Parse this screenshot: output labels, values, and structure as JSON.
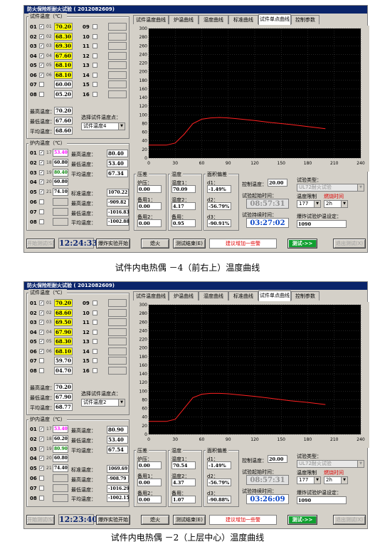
{
  "screens": [
    {
      "title": "防火保险柜耐火试验  ( 2012082609)",
      "sample_group_title": "试件温度（℃）",
      "sample_rows": [
        {
          "num": "01",
          "id": "01",
          "checked": true,
          "value": "70.20",
          "color": "#ffff00"
        },
        {
          "num": "02",
          "id": "02",
          "checked": true,
          "value": "68.30",
          "color": "#ffff00"
        },
        {
          "num": "03",
          "id": "03",
          "checked": true,
          "value": "69.30",
          "color": "#ffff00"
        },
        {
          "num": "04",
          "id": "04",
          "checked": true,
          "value": "67.60",
          "color": "#ffff00"
        },
        {
          "num": "05",
          "id": "05",
          "checked": true,
          "value": "68.10",
          "color": "#ffff00"
        },
        {
          "num": "06",
          "id": "06",
          "checked": true,
          "value": "68.10",
          "color": "#ffff00"
        },
        {
          "num": "07",
          "id": "",
          "checked": false,
          "value": "60.00",
          "color": "#ffffff"
        },
        {
          "num": "08",
          "id": "",
          "checked": false,
          "value": "05.20",
          "color": "#ffffff"
        }
      ],
      "sample_rows_right": [
        "09",
        "10",
        "11",
        "12",
        "13",
        "14",
        "15",
        "16"
      ],
      "max_label": "最高温度：",
      "max_value": "70.20",
      "min_label": "最低温度：",
      "min_value": "67.60",
      "avg_label": "平均温度：",
      "avg_value": "68.60",
      "select_label": "选择试件温度点：",
      "select_value": "试件温度4",
      "furnace_title": "炉内温度（℃）",
      "furnace_rows": [
        {
          "num": "01",
          "id": "17",
          "checked": true,
          "value": "53.40",
          "color": "#ff00ff"
        },
        {
          "num": "02",
          "id": "18",
          "checked": true,
          "value": "60.80",
          "color": "#000000"
        },
        {
          "num": "03",
          "id": "19",
          "checked": true,
          "value": "80.40",
          "color": "#008000"
        },
        {
          "num": "04",
          "id": "20",
          "checked": true,
          "value": "60.80",
          "color": "#000000"
        },
        {
          "num": "05",
          "id": "21",
          "checked": true,
          "value": "74.10",
          "color": "#000000"
        },
        {
          "num": "06",
          "id": "",
          "checked": false,
          "value": "",
          "color": "#000000"
        },
        {
          "num": "07",
          "id": "",
          "checked": false,
          "value": "",
          "color": "#000000"
        },
        {
          "num": "08",
          "id": "",
          "checked": false,
          "value": "",
          "color": "#000000"
        }
      ],
      "furnace_stats": [
        {
          "label": "最高温度：",
          "value": "80.40"
        },
        {
          "label": "最低温度：",
          "value": "53.40"
        },
        {
          "label": "平均温度：",
          "value": "67.34"
        }
      ],
      "std_stats": [
        {
          "label": "标准温度：",
          "value": "1070.22"
        },
        {
          "label": "最高温度：",
          "value": "-909.82"
        },
        {
          "label": "最低温度：",
          "value": "-1016.83"
        },
        {
          "label": "平均温度：",
          "value": "-1002.88"
        }
      ],
      "tabs": [
        "试件温度曲线",
        "炉温曲线",
        "湿度曲线",
        "标准曲线",
        "试件单点曲线",
        "控制参数"
      ],
      "active_tab": 4,
      "chart_data": {
        "type": "line",
        "xlim": [
          0,
          240
        ],
        "ylim": [
          0,
          300
        ],
        "xticks": [
          "0",
          "30",
          "60",
          "90",
          "120",
          "150",
          "180",
          "210",
          "240"
        ],
        "yticks": [
          "0",
          "20",
          "40",
          "60",
          "80",
          "100",
          "120",
          "140",
          "160",
          "180",
          "200",
          "220",
          "240",
          "260",
          "280",
          "300"
        ],
        "series": [
          {
            "color": "#ff2020",
            "x": [
              0,
              20,
              30,
              40,
              50,
              60,
              70,
              80,
              90,
              100,
              120,
              140,
              160,
              180,
              200
            ],
            "y": [
              30,
              30,
              35,
              55,
              80,
              90,
              93,
              94,
              93,
              91,
              87,
              82,
              78,
              73,
              68
            ]
          }
        ]
      },
      "pressure_title": "压差",
      "pressure": [
        {
          "label": "炉压：",
          "value": "0.00"
        },
        {
          "label": "备用1：",
          "value": "0.00"
        },
        {
          "label": "备用2：",
          "value": "0.00"
        }
      ],
      "humid_title": "湿度",
      "humid": [
        {
          "label": "湿度1：",
          "value": "70.09"
        },
        {
          "label": "湿度2：",
          "value": "4.17"
        },
        {
          "label": "备用：",
          "value": "0.95"
        }
      ],
      "area_title": "面积偏差",
      "area": [
        {
          "label": "d1：",
          "value": "-1.49%"
        },
        {
          "label": "d2：",
          "value": "-56.79%"
        },
        {
          "label": "d3：",
          "value": "-90.91%"
        }
      ],
      "ctrl_temp_label": "控制温度：",
      "ctrl_temp_value": "20.00",
      "start_time_label": "试验起始时间：",
      "start_time_value": "08:57:31",
      "elapsed_label": "试验持续时间：",
      "elapsed_value": "03:27:02",
      "test_type_label": "试验类型：",
      "test_type_value": "UL72耐火试验",
      "temp_limit_label": "温度限制",
      "fire_time_label": "燃烧时间",
      "temp_limit_value": "177",
      "fire_time_value": "2h",
      "explosion_label": "爆炸试验炉温设定：",
      "explosion_value": "1090",
      "btn_start": "开始测试(S)",
      "clock": "12:24:33",
      "btn_explode": "爆炸实验开始",
      "btn_fire": "熄火",
      "btn_end": "测试结束(E)",
      "hint": "建议增加一些警",
      "btn_test": "测试->>",
      "btn_exit": "退出测试(X)",
      "caption": "试件内电热偶  －4（前右上）温度曲线"
    },
    {
      "title": "防火保险柜耐火试验  ( 2012082609)",
      "sample_group_title": "试件温度（℃）",
      "sample_rows": [
        {
          "num": "01",
          "id": "01",
          "checked": true,
          "value": "70.20",
          "color": "#ffff00"
        },
        {
          "num": "02",
          "id": "02",
          "checked": true,
          "value": "68.60",
          "color": "#ffff00"
        },
        {
          "num": "03",
          "id": "03",
          "checked": true,
          "value": "69.50",
          "color": "#ffff00"
        },
        {
          "num": "04",
          "id": "04",
          "checked": true,
          "value": "67.90",
          "color": "#ffff00"
        },
        {
          "num": "05",
          "id": "05",
          "checked": true,
          "value": "68.30",
          "color": "#ffff00"
        },
        {
          "num": "06",
          "id": "06",
          "checked": true,
          "value": "68.10",
          "color": "#ffff00"
        },
        {
          "num": "07",
          "id": "",
          "checked": false,
          "value": "59.70",
          "color": "#ffffff"
        },
        {
          "num": "08",
          "id": "",
          "checked": false,
          "value": "04.70",
          "color": "#ffffff"
        }
      ],
      "sample_rows_right": [
        "09",
        "10",
        "11",
        "12",
        "13",
        "14",
        "15",
        "16"
      ],
      "max_label": "最高温度：",
      "max_value": "70.20",
      "min_label": "最低温度：",
      "min_value": "67.90",
      "avg_label": "平均温度：",
      "avg_value": "68.77",
      "select_label": "选择试件温度点：",
      "select_value": "试件温度2",
      "furnace_title": "炉内温度（℃）",
      "furnace_rows": [
        {
          "num": "01",
          "id": "17",
          "checked": true,
          "value": "53.40",
          "color": "#ff00ff"
        },
        {
          "num": "02",
          "id": "18",
          "checked": true,
          "value": "60.20",
          "color": "#000000"
        },
        {
          "num": "03",
          "id": "19",
          "checked": true,
          "value": "80.90",
          "color": "#008000"
        },
        {
          "num": "04",
          "id": "20",
          "checked": true,
          "value": "60.80",
          "color": "#000000"
        },
        {
          "num": "05",
          "id": "21",
          "checked": true,
          "value": "74.40",
          "color": "#000000"
        },
        {
          "num": "06",
          "id": "",
          "checked": false,
          "value": "",
          "color": "#000000"
        },
        {
          "num": "07",
          "id": "",
          "checked": false,
          "value": "",
          "color": "#000000"
        },
        {
          "num": "08",
          "id": "",
          "checked": false,
          "value": "",
          "color": "#000000"
        }
      ],
      "furnace_stats": [
        {
          "label": "最高温度：",
          "value": "80.90"
        },
        {
          "label": "最低温度：",
          "value": "53.40"
        },
        {
          "label": "平均温度：",
          "value": "67.54"
        }
      ],
      "std_stats": [
        {
          "label": "标准温度：",
          "value": "1069.69"
        },
        {
          "label": "最高温度：",
          "value": "-908.79"
        },
        {
          "label": "最低温度：",
          "value": "-1016.29"
        },
        {
          "label": "平均温度：",
          "value": "-1002.15"
        }
      ],
      "tabs": [
        "试件温度曲线",
        "炉温曲线",
        "湿度曲线",
        "标准曲线",
        "试件单点曲线",
        "控制参数"
      ],
      "active_tab": 4,
      "chart_data": {
        "type": "line",
        "xlim": [
          0,
          240
        ],
        "ylim": [
          0,
          300
        ],
        "xticks": [
          "0",
          "30",
          "60",
          "90",
          "120",
          "150",
          "180",
          "210",
          "240"
        ],
        "yticks": [
          "0",
          "20",
          "40",
          "60",
          "80",
          "100",
          "120",
          "140",
          "160",
          "180",
          "200",
          "220",
          "240",
          "260",
          "280",
          "300"
        ],
        "series": [
          {
            "color": "#ff2020",
            "x": [
              0,
              20,
              30,
              40,
              50,
              60,
              70,
              80,
              90,
              100,
              120,
              140,
              160,
              180,
              200
            ],
            "y": [
              30,
              30,
              35,
              60,
              85,
              93,
              95,
              95,
              94,
              92,
              88,
              83,
              78,
              74,
              69
            ]
          }
        ]
      },
      "pressure_title": "压差",
      "pressure": [
        {
          "label": "炉压：",
          "value": "0.00"
        },
        {
          "label": "备用1：",
          "value": "0.00"
        },
        {
          "label": "备用2：",
          "value": "0.00"
        }
      ],
      "humid_title": "湿度",
      "humid": [
        {
          "label": "湿度1：",
          "value": "70.54"
        },
        {
          "label": "湿度2：",
          "value": "4.37"
        },
        {
          "label": "备用：",
          "value": "1.07"
        }
      ],
      "area_title": "面积偏差",
      "area": [
        {
          "label": "d1：",
          "value": "-1.49%"
        },
        {
          "label": "d2：",
          "value": "-56.79%"
        },
        {
          "label": "d3：",
          "value": "-90.88%"
        }
      ],
      "ctrl_temp_label": "控制温度：",
      "ctrl_temp_value": "20.00",
      "start_time_label": "试验起始时间：",
      "start_time_value": "08:57:31",
      "elapsed_label": "试验持续时间：",
      "elapsed_value": "03:26:09",
      "test_type_label": "试验类型：",
      "test_type_value": "UL72耐火试验",
      "temp_limit_label": "温度限制",
      "fire_time_label": "燃烧时间",
      "temp_limit_value": "177",
      "fire_time_value": "2h",
      "explosion_label": "爆炸试验炉温设定：",
      "explosion_value": "1090",
      "btn_start": "开始测试(S)",
      "clock": "12:23:40",
      "btn_explode": "爆炸实验开始",
      "btn_fire": "熄火",
      "btn_end": "测试结束(E)",
      "hint": "建议增加一些警",
      "btn_test": "测试->>",
      "btn_exit": "退出测试(X)",
      "caption": "试件内电热偶  －2（上层中心）温度曲线"
    }
  ]
}
